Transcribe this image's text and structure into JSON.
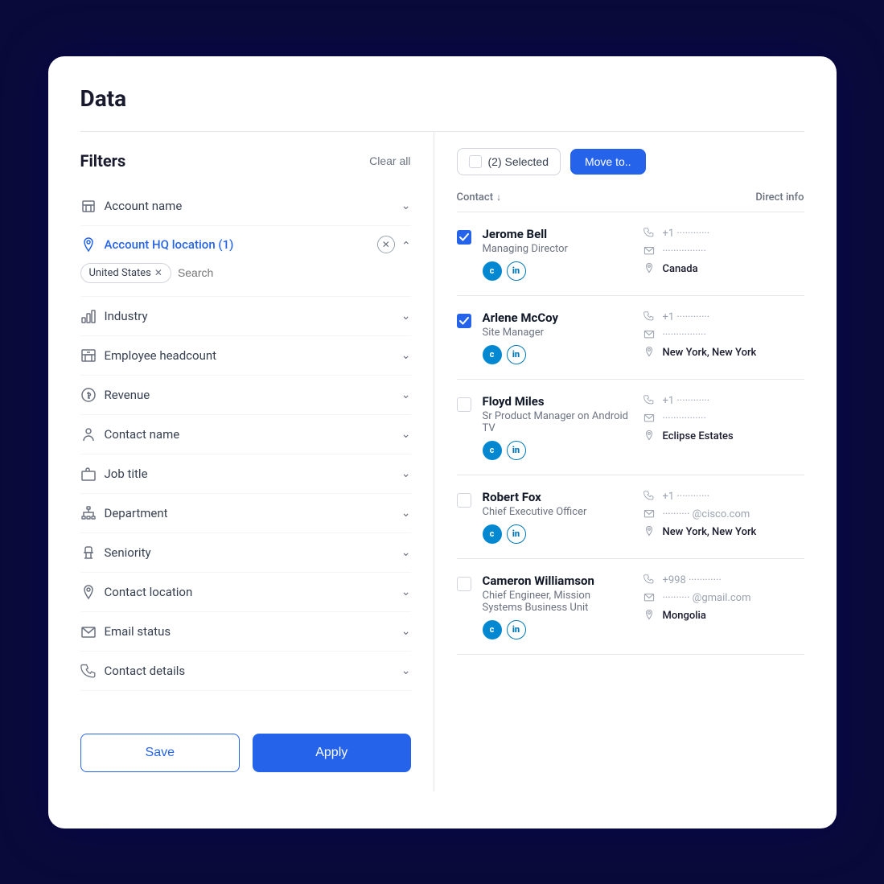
{
  "page": {
    "title": "Data"
  },
  "filters": {
    "title": "Filters",
    "clear_all": "Clear all",
    "items": [
      {
        "id": "account-name",
        "label": "Account name",
        "icon": "building",
        "active": false,
        "expanded": false
      },
      {
        "id": "account-hq",
        "label": "Account HQ location (1)",
        "icon": "location",
        "active": true,
        "expanded": true
      },
      {
        "id": "industry",
        "label": "Industry",
        "icon": "chart",
        "active": false,
        "expanded": false
      },
      {
        "id": "employee-headcount",
        "label": "Employee headcount",
        "icon": "building2",
        "active": false,
        "expanded": false
      },
      {
        "id": "revenue",
        "label": "Revenue",
        "icon": "dollar",
        "active": false,
        "expanded": false
      },
      {
        "id": "contact-name",
        "label": "Contact name",
        "icon": "person",
        "active": false,
        "expanded": false
      },
      {
        "id": "job-title",
        "label": "Job title",
        "icon": "briefcase",
        "active": false,
        "expanded": false
      },
      {
        "id": "department",
        "label": "Department",
        "icon": "org",
        "active": false,
        "expanded": false
      },
      {
        "id": "seniority",
        "label": "Seniority",
        "icon": "chair",
        "active": false,
        "expanded": false
      },
      {
        "id": "contact-location",
        "label": "Contact location",
        "icon": "location",
        "active": false,
        "expanded": false
      },
      {
        "id": "email-status",
        "label": "Email status",
        "icon": "email",
        "active": false,
        "expanded": false
      },
      {
        "id": "contact-details",
        "label": "Contact details",
        "icon": "phone",
        "active": false,
        "expanded": false
      }
    ],
    "hq_filter": {
      "tag": "United States",
      "search_placeholder": "Search"
    }
  },
  "actions": {
    "save_label": "Save",
    "apply_label": "Apply"
  },
  "results": {
    "selected_count": "(2) Selected",
    "move_to_label": "Move to..",
    "col_contact": "Contact",
    "col_direct": "Direct info",
    "contacts": [
      {
        "name": "Jerome Bell",
        "title": "Managing Director",
        "checked": true,
        "phone": "+1 ············",
        "email": "················",
        "location": "Canada",
        "email_domain": ""
      },
      {
        "name": "Arlene McCoy",
        "title": "Site Manager",
        "checked": true,
        "phone": "+1 ············",
        "email": "················",
        "location": "New York, New York",
        "email_domain": ""
      },
      {
        "name": "Floyd Miles",
        "title": "Sr Product Manager on Android TV",
        "checked": false,
        "phone": "+1 ············",
        "email": "················",
        "location": "Eclipse Estates",
        "email_domain": ""
      },
      {
        "name": "Robert Fox",
        "title": "Chief Executive Officer",
        "checked": false,
        "phone": "+1 ············",
        "email": "·········· @cisco.com",
        "location": "New York, New York",
        "email_domain": "@cisco.com"
      },
      {
        "name": "Cameron Williamson",
        "title": "Chief Engineer, Mission Systems Business Unit",
        "checked": false,
        "phone": "+998 ············",
        "email": "·········· @gmail.com",
        "location": "Mongolia",
        "email_domain": "@gmail.com"
      }
    ]
  }
}
